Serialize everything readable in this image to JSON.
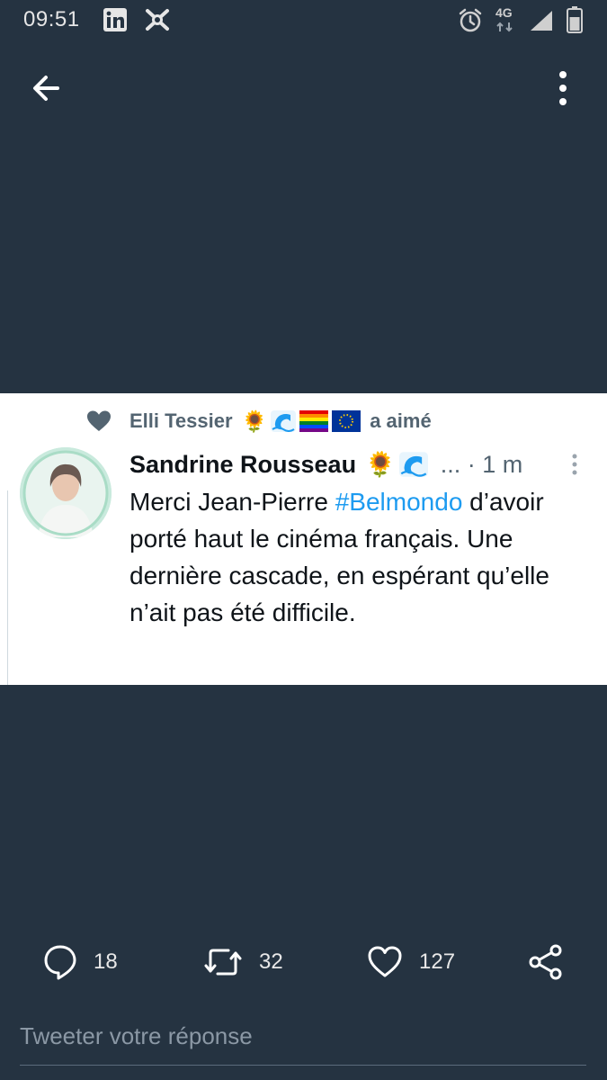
{
  "status_bar": {
    "time": "09:51",
    "network": "4G",
    "icons": [
      "linkedin-icon",
      "app-icon",
      "alarm-icon",
      "signal-icon",
      "battery-icon"
    ]
  },
  "app_bar": {
    "back_icon": "arrow-left-icon",
    "more_icon": "more-vertical-icon"
  },
  "tweet": {
    "liked_by": {
      "name": "Elli Tessier",
      "emojis": [
        "🌻",
        "🌊",
        "🏳️‍🌈",
        "🇪🇺"
      ],
      "action": "a aimé"
    },
    "author": {
      "name": "Sandrine Rousseau",
      "emojis": [
        "🌻",
        "🌊"
      ],
      "meta": "... · 1 m"
    },
    "text_before": "Merci Jean-Pierre ",
    "hashtag": "#Belmondo",
    "text_after": " d’avoir porté haut le cinéma français. Une dernière cascade, en espérant qu’elle n’ait pas été difficile."
  },
  "actions": {
    "replies": "18",
    "retweets": "32",
    "likes": "127"
  },
  "reply_box": {
    "placeholder": "Tweeter votre réponse"
  },
  "colors": {
    "background": "#253341",
    "hashtag": "#1d9bf0",
    "muted": "#536471"
  }
}
